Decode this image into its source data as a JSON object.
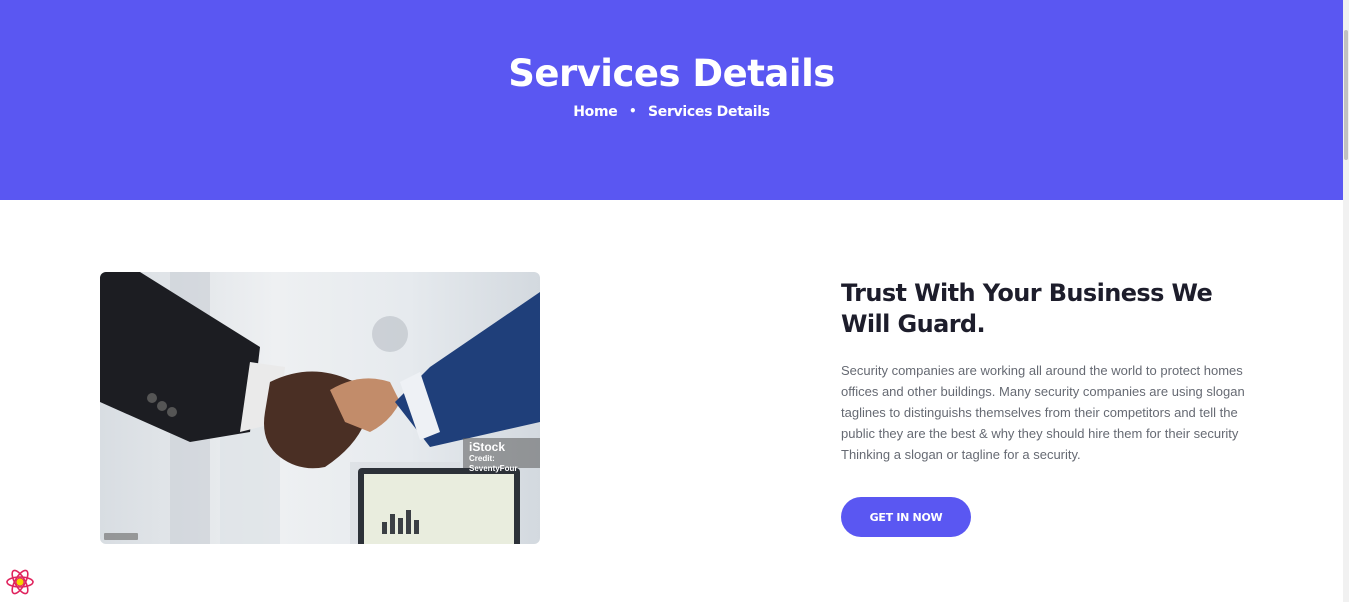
{
  "banner": {
    "title": "Services Details",
    "breadcrumb": {
      "home": "Home",
      "separator": "•",
      "current": "Services Details"
    },
    "color": "#5a57f2"
  },
  "service": {
    "heading": "Trust With Your Business We Will Guard.",
    "description": "Security companies are working all around the world to protect homes offices and other buildings. Many security companies are using slogan taglines to distinguishs themselves from their competitors and tell the public they are the best & why they should hire them for their security Thinking a slogan or tagline for a security.",
    "cta_label": "GET IN NOW",
    "image": {
      "watermark_brand": "iStock",
      "watermark_credit": "Credit: SeventyFour",
      "subject": "handshake"
    }
  },
  "icons": {
    "devtools": "react-icon"
  },
  "colors": {
    "accent": "#5a57f2",
    "heading_text": "#1d1d2b",
    "body_text": "#666a73"
  }
}
